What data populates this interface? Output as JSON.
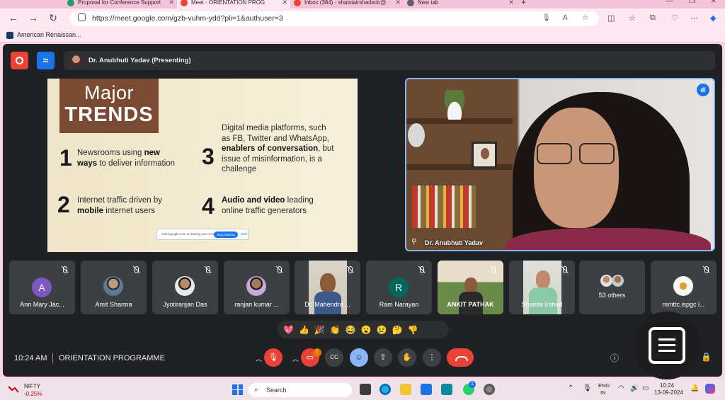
{
  "browser": {
    "tabs": [
      {
        "label": "Proposal for Conference Support",
        "icon_color": "#22a06b",
        "active": false
      },
      {
        "label": "Meet - ORIENTATION PROG",
        "icon_color": "#ea4335",
        "active": true
      },
      {
        "label": "Inbox (384) - shaistairshadsdc@",
        "icon_color": "#ea4335",
        "active": false
      },
      {
        "label": "New tab",
        "icon_color": "#5f6368",
        "active": false
      }
    ],
    "url": "https://meet.google.com/gzb-vuhm-ydd?pli=1&authuser=3",
    "bookmark": "American Renaissan..."
  },
  "meet": {
    "presenter_label": "Dr. Anubhuti Yadav (Presenting)",
    "slide": {
      "title_line1": "Major",
      "title_line2": "TRENDS",
      "items": [
        {
          "num": "1",
          "pre": "Newsrooms using ",
          "bold": "new ways",
          "post": " to deliver information"
        },
        {
          "num": "2",
          "pre": "Internet traffic driven by ",
          "bold": "mobile",
          "post": " internet users"
        },
        {
          "num": "3",
          "pre": "Digital media platforms, such as FB, Twitter and WhatsApp, ",
          "bold": "enablers of conversation",
          "post": ", but issue of misinformation, is a challenge"
        },
        {
          "num": "4",
          "pre": "",
          "bold": "Audio and video",
          "post": " leading online traffic generators"
        }
      ],
      "share_text": "meet.google.com is sharing your screen.",
      "stop_label": "Stop sharing",
      "hide_label": "Hide"
    },
    "speaker_name": "Dr. Anubhuti Yadav",
    "participants": [
      {
        "name": "Ann Mary Jac...",
        "initial": "A",
        "color": "#7e57c2",
        "kind": "initial"
      },
      {
        "name": "Amit Sharma",
        "initial": "",
        "color": "",
        "kind": "photo"
      },
      {
        "name": "Jyotiranjan Das",
        "initial": "",
        "color": "",
        "kind": "photo"
      },
      {
        "name": "ranjan kumar ...",
        "initial": "",
        "color": "",
        "kind": "photo"
      },
      {
        "name": "Dr. Mahendra ...",
        "initial": "",
        "color": "",
        "kind": "video"
      },
      {
        "name": "Ram Narayan",
        "initial": "R",
        "color": "#00695c",
        "kind": "initial"
      },
      {
        "name": "ANKIT PATHAK",
        "initial": "",
        "color": "",
        "kind": "video"
      },
      {
        "name": "Shaista Irshad",
        "initial": "",
        "color": "",
        "kind": "video"
      },
      {
        "name": "53 others",
        "initial": "",
        "color": "",
        "kind": "group"
      },
      {
        "name": "mmttc.ispgc i...",
        "initial": "",
        "color": "",
        "kind": "photo"
      }
    ],
    "reactions": [
      "💖",
      "👍",
      "🎉",
      "👏",
      "😂",
      "😮",
      "😢",
      "🤔",
      "👎"
    ],
    "time": "10:24 AM",
    "meeting_title": "ORIENTATION PROGRAMME",
    "camera_notification_count": "!"
  },
  "taskbar": {
    "stock_name": "NIFTY",
    "stock_change": "-0.25%",
    "search_placeholder": "Search",
    "lang_line1": "ENG",
    "lang_line2": "IN",
    "time": "10:24",
    "date": "13-09-2024",
    "whatsapp_badge": "1"
  }
}
